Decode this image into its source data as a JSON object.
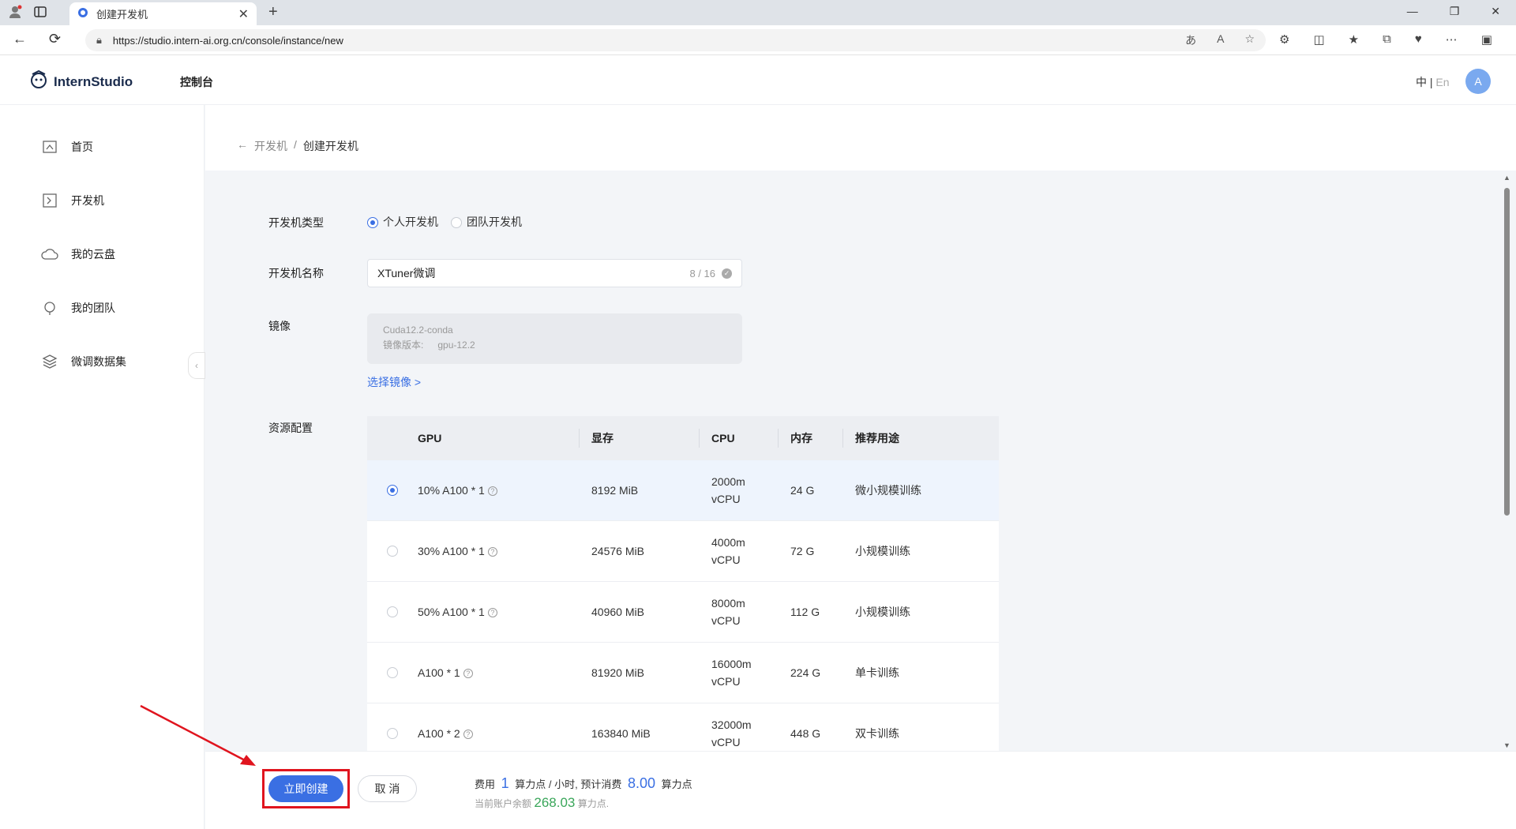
{
  "browser": {
    "tab_title": "创建开发机",
    "url": "https://studio.intern-ai.org.cn/console/instance/new"
  },
  "header": {
    "logo_text": "InternStudio",
    "console": "控制台",
    "lang_zh": "中",
    "lang_sep": "|",
    "lang_en": "En",
    "avatar": "A"
  },
  "sidebar": {
    "items": [
      {
        "label": "首页",
        "icon": "home-icon"
      },
      {
        "label": "开发机",
        "icon": "terminal-icon"
      },
      {
        "label": "我的云盘",
        "icon": "cloud-icon"
      },
      {
        "label": "我的团队",
        "icon": "team-icon"
      },
      {
        "label": "微调数据集",
        "icon": "layers-icon"
      }
    ]
  },
  "breadcrumb": {
    "parent": "开发机",
    "sep": "/",
    "current": "创建开发机"
  },
  "form": {
    "type_label": "开发机类型",
    "type_options": [
      "个人开发机",
      "团队开发机"
    ],
    "type_selected": "个人开发机",
    "name_label": "开发机名称",
    "name_value": "XTuner微调",
    "name_count": "8 / 16",
    "image_label": "镜像",
    "image_name": "Cuda12.2-conda",
    "image_version_label": "镜像版本:",
    "image_version": "gpu-12.2",
    "select_image": "选择镜像 >",
    "resource_label": "资源配置",
    "columns": [
      "GPU",
      "显存",
      "CPU",
      "内存",
      "推荐用途"
    ],
    "rows": [
      {
        "gpu": "10% A100 * 1",
        "vram": "8192 MiB",
        "cpu1": "2000m",
        "cpu2": "vCPU",
        "mem": "24 G",
        "use": "微小规模训练",
        "selected": true
      },
      {
        "gpu": "30% A100 * 1",
        "vram": "24576 MiB",
        "cpu1": "4000m",
        "cpu2": "vCPU",
        "mem": "72 G",
        "use": "小规模训练",
        "selected": false
      },
      {
        "gpu": "50% A100 * 1",
        "vram": "40960 MiB",
        "cpu1": "8000m",
        "cpu2": "vCPU",
        "mem": "112 G",
        "use": "小规模训练",
        "selected": false
      },
      {
        "gpu": "A100 * 1",
        "vram": "81920 MiB",
        "cpu1": "16000m",
        "cpu2": "vCPU",
        "mem": "224 G",
        "use": "单卡训练",
        "selected": false
      },
      {
        "gpu": "A100 * 2",
        "vram": "163840 MiB",
        "cpu1": "32000m",
        "cpu2": "vCPU",
        "mem": "448 G",
        "use": "双卡训练",
        "selected": false
      }
    ]
  },
  "footer": {
    "create": "立即创建",
    "cancel": "取 消",
    "fee_label": "费用",
    "fee_value": "1",
    "fee_unit": "算力点 / 小时, 预计消费",
    "est_value": "8.00",
    "est_unit": "算力点",
    "balance_label": "当前账户余额",
    "balance_value": "268.03",
    "balance_unit": "算力点."
  },
  "colors": {
    "accent": "#3a6fe3",
    "highlight": "#e0141e",
    "balance": "#3aa65a"
  }
}
